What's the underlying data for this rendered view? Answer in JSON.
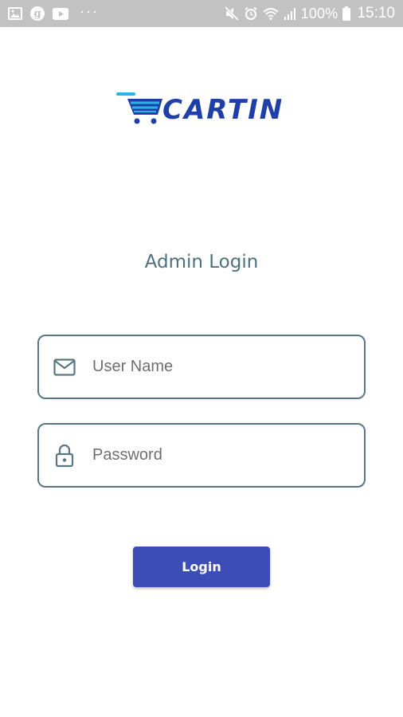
{
  "status_bar": {
    "left_icons": [
      "image-icon",
      "g-badge",
      "youtube-icon",
      "more-dots-icon"
    ],
    "g_label": "g",
    "dots_label": "···",
    "battery_text": "100%",
    "time": "15:10",
    "right_icons": [
      "mute-icon",
      "alarm-icon",
      "wifi-icon",
      "signal-icon",
      "battery-icon"
    ]
  },
  "logo": {
    "text": "CARTIN",
    "icon": "shopping-cart-icon",
    "colors": {
      "primary": "#1f3fa8",
      "accent": "#29b6e6"
    }
  },
  "page": {
    "title": "Admin Login"
  },
  "form": {
    "username": {
      "placeholder": "User Name",
      "value": "",
      "icon": "mail-icon"
    },
    "password": {
      "placeholder": "Password",
      "value": "",
      "icon": "lock-icon"
    },
    "login_label": "Login"
  },
  "colors": {
    "status_bar_bg": "#c2c2c2",
    "field_border": "#5b7683",
    "title": "#4e6f7e",
    "button_bg": "#3d4db7",
    "button_text": "#ffffff"
  }
}
